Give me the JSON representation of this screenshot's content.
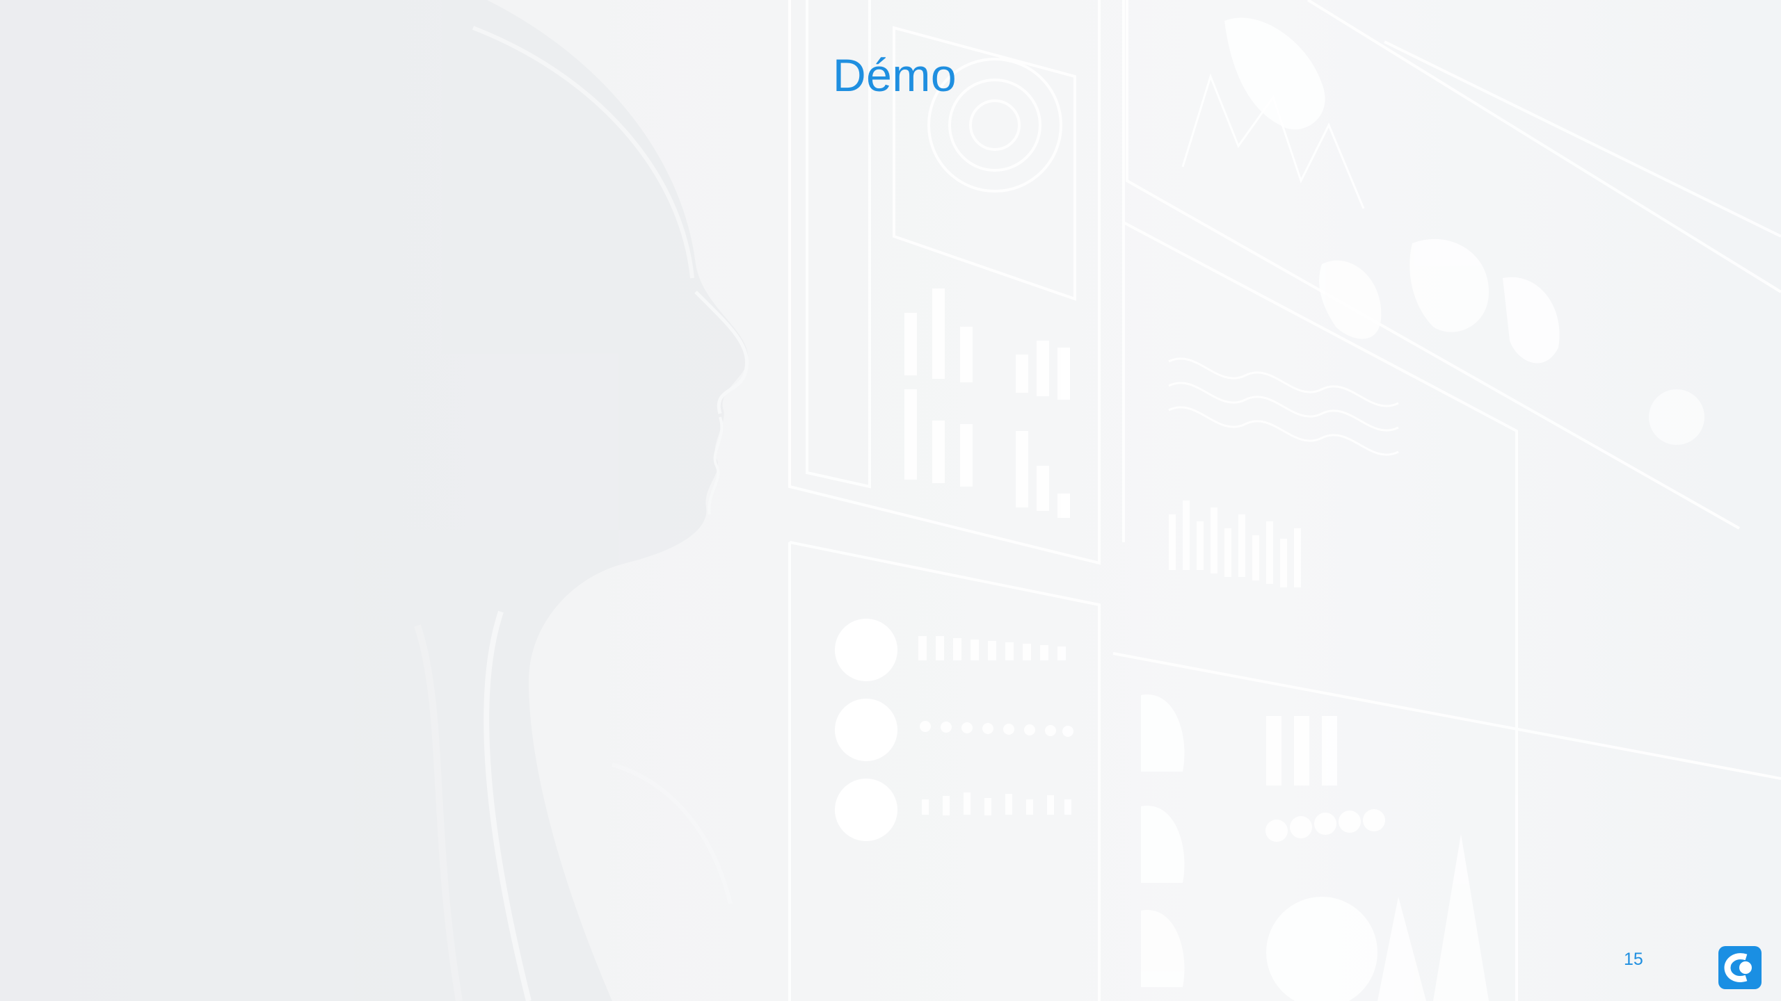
{
  "slide": {
    "title": "Démo",
    "page_number": "15"
  },
  "background": {
    "description_icon": "person-profile-hud-dashboard-image"
  },
  "logo": {
    "icon": "brand-logo-icon",
    "color": "#1a8fe3"
  },
  "colors": {
    "accent": "#1f8fe0",
    "background": "#f3f4f5"
  }
}
